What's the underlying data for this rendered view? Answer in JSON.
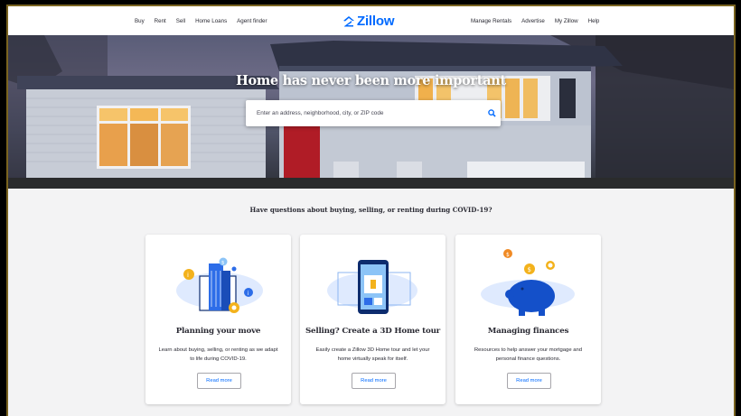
{
  "nav": {
    "left": [
      "Buy",
      "Rent",
      "Sell",
      "Home Loans",
      "Agent finder"
    ],
    "right": [
      "Manage Rentals",
      "Advertise",
      "My Zillow",
      "Help"
    ],
    "logo": "Zillow",
    "brand_color": "#006aff"
  },
  "hero": {
    "title": "Home has never been more important",
    "search_placeholder": "Enter an address, neighborhood, city, or ZIP code"
  },
  "section": {
    "question": "Have questions about buying, selling, or renting during COVID-19?",
    "cards": [
      {
        "icon": "building-plan-icon",
        "title": "Planning your move",
        "description": "Learn about buying, selling, or renting as we adapt to life during COVID-19.",
        "button": "Read more"
      },
      {
        "icon": "phone-3d-tour-icon",
        "title": "Selling? Create a 3D Home tour",
        "description": "Easily create a Zillow 3D Home tour and let your home virtually speak for itself.",
        "button": "Read more"
      },
      {
        "icon": "piggy-bank-icon",
        "title": "Managing finances",
        "description": "Resources to help answer your mortgage and personal finance questions.",
        "button": "Read more"
      }
    ]
  }
}
